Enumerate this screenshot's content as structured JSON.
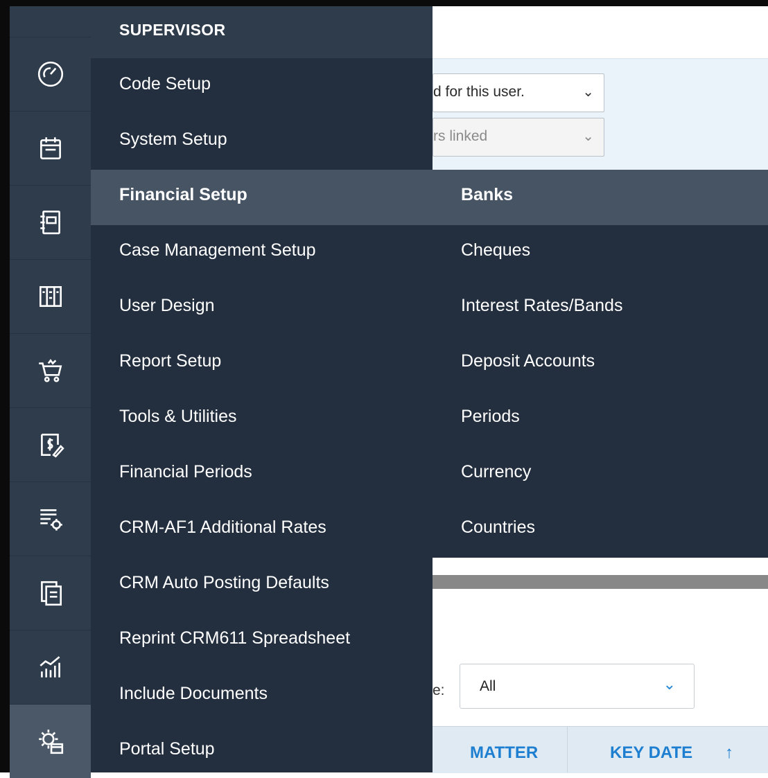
{
  "background": {
    "user_select": {
      "value": "d for this user."
    },
    "linked_select": {
      "value": "rs linked"
    },
    "filter_label": "e:",
    "filter_dropdown": {
      "value": "All"
    },
    "table_headers": {
      "matter": "MATTER",
      "key_date": "KEY DATE",
      "sort_arrow": "↑"
    }
  },
  "menu": {
    "header": "SUPERVISOR",
    "items": [
      {
        "label": "Code Setup"
      },
      {
        "label": "System Setup"
      },
      {
        "label": "Financial Setup"
      },
      {
        "label": "Case Management Setup"
      },
      {
        "label": "User Design"
      },
      {
        "label": "Report Setup"
      },
      {
        "label": "Tools & Utilities"
      },
      {
        "label": "Financial Periods"
      },
      {
        "label": "CRM-AF1 Additional Rates"
      },
      {
        "label": "CRM Auto Posting Defaults"
      },
      {
        "label": "Reprint CRM611 Spreadsheet"
      },
      {
        "label": "Include Documents"
      },
      {
        "label": "Portal Setup"
      }
    ],
    "active_item": "Financial Setup"
  },
  "submenu": {
    "items": [
      {
        "label": "Banks"
      },
      {
        "label": "Cheques"
      },
      {
        "label": "Interest Rates/Bands"
      },
      {
        "label": "Deposit Accounts"
      },
      {
        "label": "Periods"
      },
      {
        "label": "Currency"
      },
      {
        "label": "Countries"
      }
    ]
  },
  "rail": {
    "icons": [
      "dashboard-gauge-icon",
      "calendar-icon",
      "notebook-icon",
      "ledger-books-icon",
      "shopping-cart-icon",
      "invoice-dollar-icon",
      "list-settings-icon",
      "documents-icon",
      "analytics-chart-icon",
      "settings-gear-calendar-icon"
    ],
    "active_icon": "settings-gear-calendar-icon"
  },
  "colors": {
    "rail_bg": "#2f3c4c",
    "menu_bg": "#232f3e",
    "menu_highlight": "#465464",
    "accent_blue": "#1e7fd0"
  }
}
